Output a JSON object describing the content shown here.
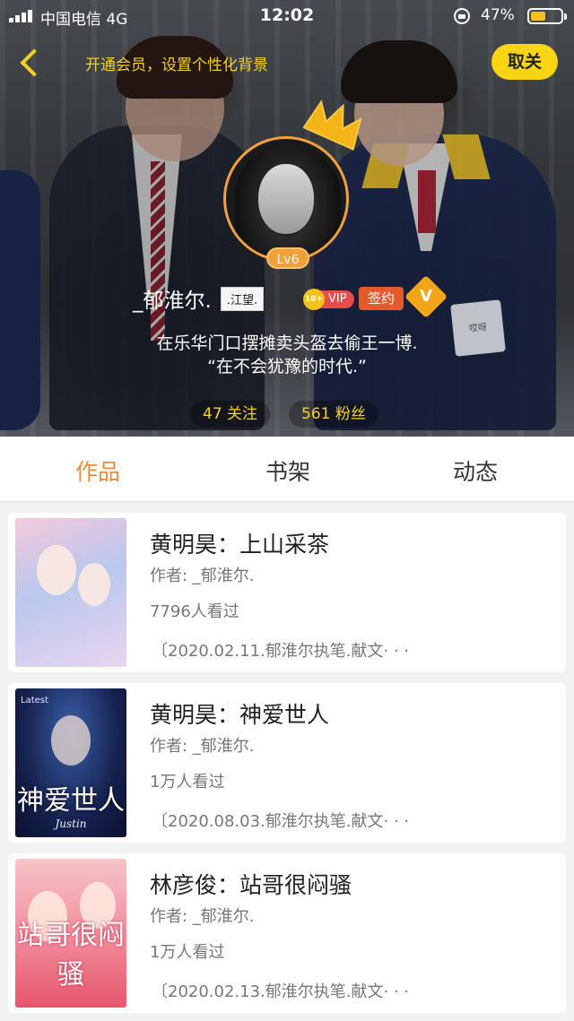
{
  "status_bar": {
    "carrier": "中国电信   4G",
    "time": "12:02",
    "battery": "47%"
  },
  "header": {
    "vip_tip": "开通会员，设置个性化背景",
    "cancel_label": "取关"
  },
  "profile": {
    "level": "Lv6",
    "username": "_郁淮尔.",
    "name_tag": ".江望.",
    "vip_label": "VIP",
    "vip_gem_text": "10+",
    "sign_label": "签约",
    "v_label": "V",
    "bio_line1": "在乐华门口摆摊卖头盔去偷王一博.",
    "bio_line2": "“在不会犹豫的时代.”",
    "following": "47 关注",
    "fans": "561 粉丝",
    "cover_card_text": "哎呀"
  },
  "tabs": [
    {
      "label": "作品",
      "active": true
    },
    {
      "label": "书架",
      "active": false
    },
    {
      "label": "动态",
      "active": false
    }
  ],
  "works": [
    {
      "title": "黄明昊：上山采茶",
      "author": "作者: _郁淮尔.",
      "views": "7796人看过",
      "desc": "〔2020.02.11.郁淮尔执笔.献文· · ·"
    },
    {
      "title": "黄明昊：神爱世人",
      "author": "作者: _郁淮尔.",
      "views": "1万人看过",
      "desc": "〔2020.08.03.郁淮尔执笔.献文· · ·",
      "cover_tag": "Latest",
      "cover_caption": "神爱世人",
      "cover_sub": "Justin"
    },
    {
      "title": "林彦俊：站哥很闷骚",
      "author": "作者: _郁淮尔.",
      "views": "1万人看过",
      "desc": "〔2020.02.13.郁淮尔执笔.献文· · ·",
      "cover_caption": "站哥很闷骚"
    }
  ],
  "colors": {
    "accent_yellow": "#f8d413",
    "accent_orange": "#f08a3a",
    "avatar_ring": "#f0a13a"
  }
}
